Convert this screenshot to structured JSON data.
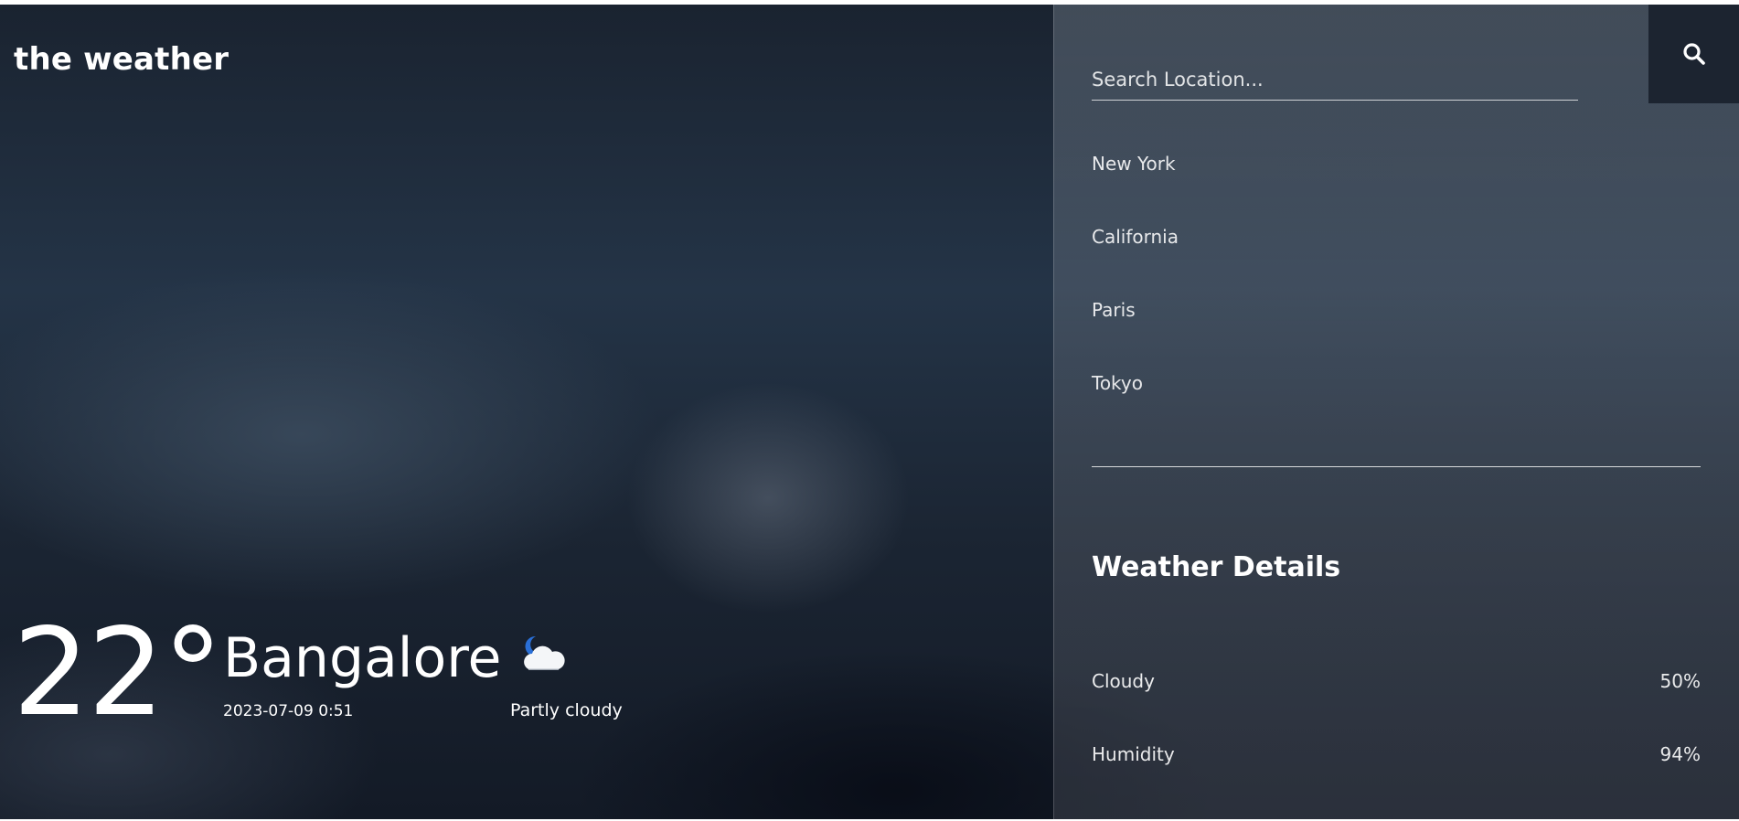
{
  "brand": "the weather",
  "current": {
    "temperature": "22°",
    "city": "Bangalore",
    "datetime": "2023-07-09 0:51",
    "condition": "Partly cloudy",
    "condition_icon": "moon-cloud-icon"
  },
  "search": {
    "placeholder": "Search Location...",
    "icon": "search-icon"
  },
  "cities": [
    "New York",
    "California",
    "Paris",
    "Tokyo"
  ],
  "details": {
    "title": "Weather Details",
    "rows": [
      {
        "label": "Cloudy",
        "value": "50%"
      },
      {
        "label": "Humidity",
        "value": "94%"
      }
    ]
  }
}
